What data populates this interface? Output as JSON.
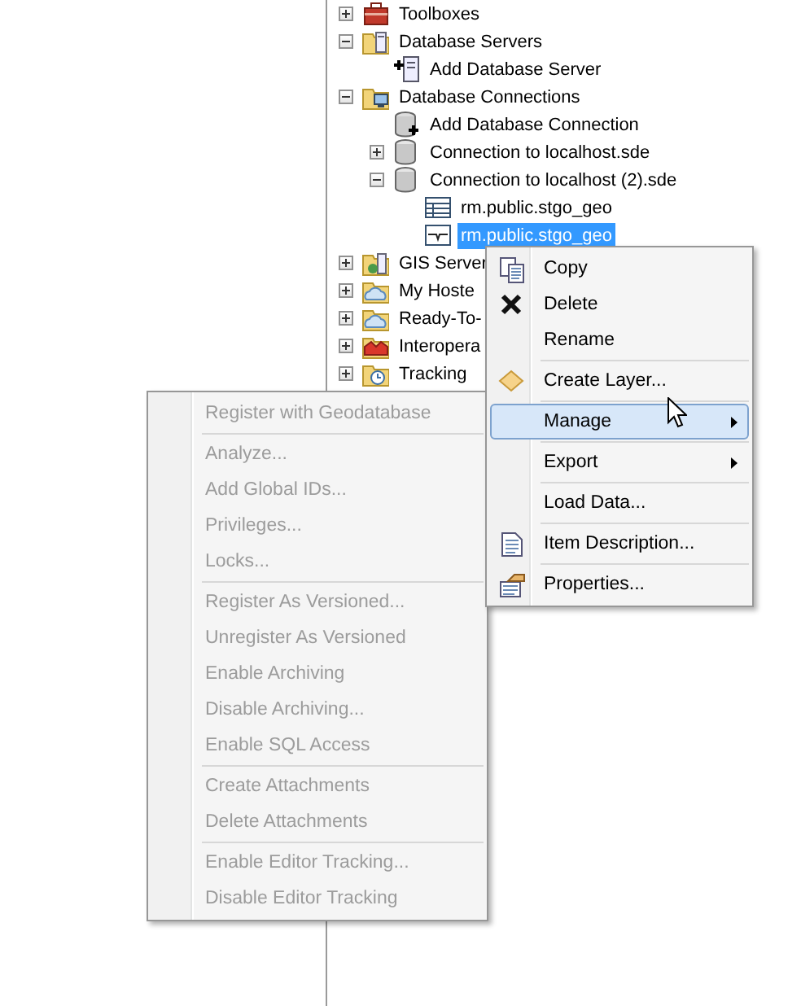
{
  "tree": [
    {
      "label": "Toolboxes",
      "kind": "toolbox",
      "expanded": false,
      "selected": false
    },
    {
      "label": "Database Servers",
      "kind": "server-folder",
      "expanded": true,
      "selected": false,
      "children": [
        {
          "label": "Add Database Server",
          "kind": "add-server",
          "selected": false
        }
      ]
    },
    {
      "label": "Database Connections",
      "kind": "connection-folder",
      "expanded": true,
      "selected": false,
      "children": [
        {
          "label": "Add Database Connection",
          "kind": "add-database",
          "selected": false
        },
        {
          "label": "Connection to localhost.sde",
          "kind": "database",
          "expanded": false,
          "selected": false
        },
        {
          "label": "Connection to localhost (2).sde",
          "kind": "database",
          "expanded": true,
          "selected": false,
          "children": [
            {
              "label": "rm.public.stgo_geo",
              "kind": "table",
              "selected": false
            },
            {
              "label": "rm.public.stgo_geo",
              "kind": "feature-class",
              "selected": true
            }
          ]
        }
      ]
    },
    {
      "label": "GIS Server",
      "kind": "gis-folder",
      "expanded": false,
      "selected": false
    },
    {
      "label": "My Hoste",
      "kind": "cloud-folder",
      "expanded": false,
      "selected": false
    },
    {
      "label": "Ready-To-",
      "kind": "cloud-folder",
      "expanded": false,
      "selected": false
    },
    {
      "label": "Interopera",
      "kind": "interop-folder",
      "expanded": false,
      "selected": false
    },
    {
      "label": "Tracking",
      "kind": "tracking-folder",
      "expanded": false,
      "selected": false
    }
  ],
  "context_menu": {
    "groups": [
      [
        {
          "label": "Copy",
          "kind": "copy",
          "selected": false
        },
        {
          "label": "Delete",
          "kind": "delete",
          "selected": false
        },
        {
          "label": "Rename",
          "kind": "plain",
          "selected": false
        }
      ],
      [
        {
          "label": "Create Layer...",
          "kind": "layer",
          "selected": false
        }
      ],
      [
        {
          "label": "Manage",
          "kind": "plain",
          "selected": true,
          "has_submenu": true,
          "submenu": {
            "groups": [
              [
                {
                  "label": "Register with Geodatabase",
                  "disabled": true
                }
              ],
              [
                {
                  "label": "Analyze...",
                  "disabled": true
                },
                {
                  "label": "Add Global IDs...",
                  "disabled": true
                },
                {
                  "label": "Privileges...",
                  "disabled": true
                },
                {
                  "label": "Locks...",
                  "disabled": true
                }
              ],
              [
                {
                  "label": "Register As Versioned...",
                  "disabled": true
                },
                {
                  "label": "Unregister As Versioned",
                  "disabled": true
                },
                {
                  "label": "Enable Archiving",
                  "disabled": true
                },
                {
                  "label": "Disable Archiving...",
                  "disabled": true
                },
                {
                  "label": "Enable SQL Access",
                  "disabled": true
                }
              ],
              [
                {
                  "label": "Create Attachments",
                  "disabled": true
                },
                {
                  "label": "Delete Attachments",
                  "disabled": true
                }
              ],
              [
                {
                  "label": "Enable Editor Tracking...",
                  "disabled": true
                },
                {
                  "label": "Disable Editor Tracking",
                  "disabled": true
                }
              ]
            ]
          }
        }
      ],
      [
        {
          "label": "Export",
          "kind": "plain",
          "selected": false,
          "has_submenu": true
        }
      ],
      [
        {
          "label": "Load Data...",
          "kind": "plain",
          "selected": false
        }
      ],
      [
        {
          "label": "Item Description...",
          "kind": "description",
          "selected": false
        }
      ],
      [
        {
          "label": "Properties...",
          "kind": "properties",
          "selected": false
        }
      ]
    ]
  }
}
